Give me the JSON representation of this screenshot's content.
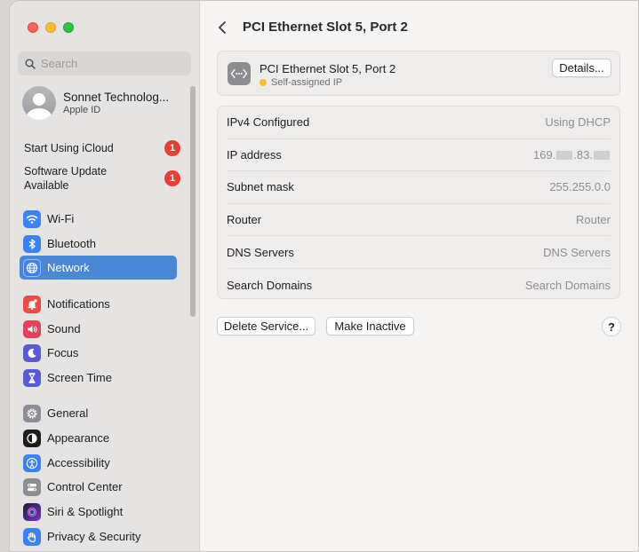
{
  "search": {
    "placeholder": "Search"
  },
  "account": {
    "name": "Sonnet Technolog...",
    "subtitle": "Apple ID"
  },
  "notices": [
    {
      "label": "Start Using iCloud",
      "badge": "1"
    },
    {
      "label": "Software Update Available",
      "badge": "1"
    }
  ],
  "sidebar": {
    "items": [
      {
        "label": "Wi-Fi",
        "icon": "wifi-icon",
        "color": "#3a82f7"
      },
      {
        "label": "Bluetooth",
        "icon": "bluetooth-icon",
        "color": "#3a82f7"
      },
      {
        "label": "Network",
        "icon": "globe-icon",
        "color": "#3a82f7",
        "active": true
      },
      {
        "label": "Notifications",
        "icon": "bell-icon",
        "color": "#ed4b42"
      },
      {
        "label": "Sound",
        "icon": "speaker-icon",
        "color": "#e5405e"
      },
      {
        "label": "Focus",
        "icon": "moon-icon",
        "color": "#5b5ad6"
      },
      {
        "label": "Screen Time",
        "icon": "hourglass-icon",
        "color": "#5b5ad6"
      },
      {
        "label": "General",
        "icon": "gear-icon",
        "color": "#8e8e93"
      },
      {
        "label": "Appearance",
        "icon": "appearance-icon",
        "color": "#1d1d1f"
      },
      {
        "label": "Accessibility",
        "icon": "accessibility-icon",
        "color": "#3a82f7"
      },
      {
        "label": "Control Center",
        "icon": "control-center-icon",
        "color": "#8e8e93"
      },
      {
        "label": "Siri & Spotlight",
        "icon": "siri-icon",
        "color": "#6b3bd1"
      },
      {
        "label": "Privacy & Security",
        "icon": "hand-icon",
        "color": "#3a82f7"
      }
    ]
  },
  "header": {
    "title": "PCI Ethernet Slot 5, Port 2"
  },
  "service": {
    "name": "PCI Ethernet Slot 5, Port 2",
    "status": "Self-assigned IP",
    "details_label": "Details..."
  },
  "details": [
    {
      "label": "IPv4 Configured",
      "value": "Using DHCP"
    },
    {
      "label": "IP address",
      "value_parts": [
        "169.",
        ".83.",
        ""
      ]
    },
    {
      "label": "Subnet mask",
      "value": "255.255.0.0"
    },
    {
      "label": "Router",
      "value": "Router"
    },
    {
      "label": "DNS Servers",
      "value": "DNS Servers"
    },
    {
      "label": "Search Domains",
      "value": "Search Domains"
    }
  ],
  "actions": {
    "delete_label": "Delete Service...",
    "inactive_label": "Make Inactive",
    "help_label": "?"
  },
  "colors": {
    "accent": "#4a87d4",
    "badge": "#ec3b33",
    "status_dot": "#f7c125"
  }
}
